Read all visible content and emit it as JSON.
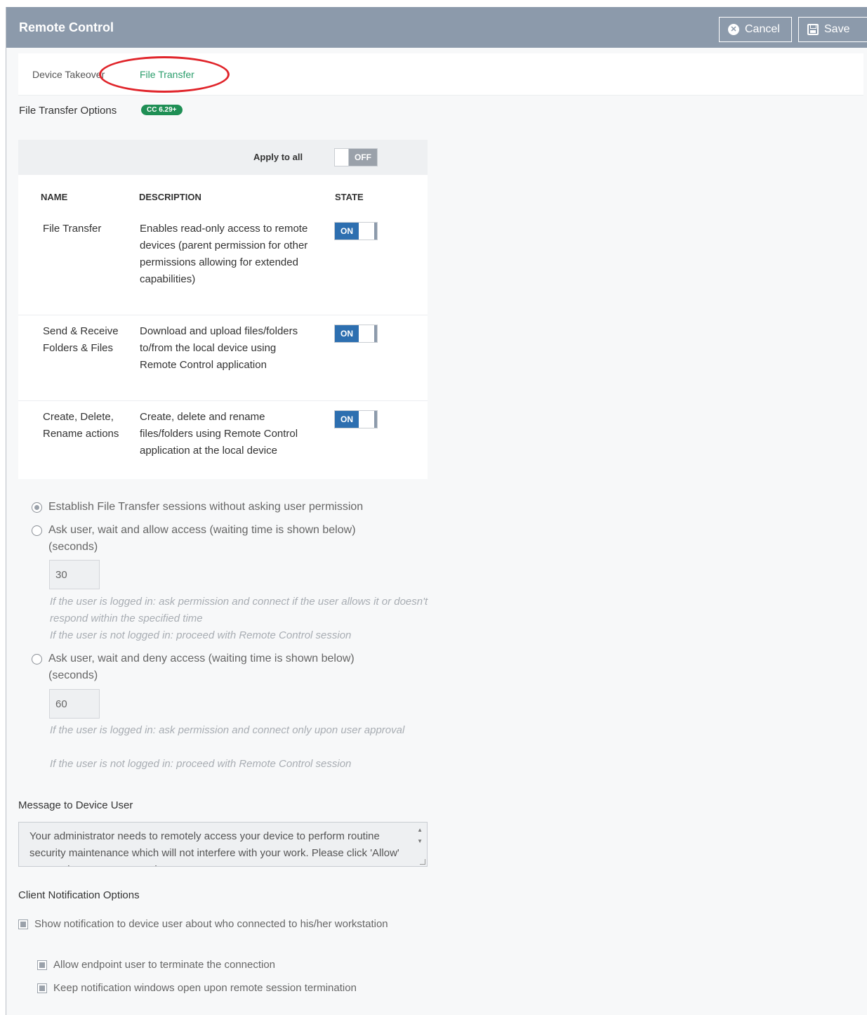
{
  "header": {
    "title": "Remote Control",
    "cancel_label": "Cancel",
    "save_label": "Save",
    "bg_color": "#8c9aab"
  },
  "tabs": [
    {
      "label": "Device Takeover",
      "active": false
    },
    {
      "label": "File Transfer",
      "active": true
    }
  ],
  "section": {
    "title": "File Transfer Options",
    "badge": "CC 6.29+"
  },
  "table": {
    "apply_to_all_label": "Apply to all",
    "apply_to_all_state": "OFF",
    "headers": {
      "name": "NAME",
      "description": "DESCRIPTION",
      "state": "STATE"
    },
    "rows": [
      {
        "name": "File Transfer",
        "description": "Enables read-only access to remote devices (parent permission for other permissions allowing for extended capabilities)",
        "state": "ON"
      },
      {
        "name": "Send & Receive Folders & Files",
        "description": "Download and upload files/folders to/from the local device using Remote Control application",
        "state": "ON"
      },
      {
        "name": "Create, Delete, Rename actions",
        "description": "Create, delete and rename files/folders using Remote Control application at the local device",
        "state": "ON"
      }
    ]
  },
  "session_options": {
    "selected": 0,
    "opt1": "Establish File Transfer sessions without asking user permission",
    "opt2": "Ask user, wait and allow access (waiting time is shown below) (seconds)",
    "opt2_value": "30",
    "opt2_note1": "If the user is logged in: ask permission and connect if the user allows it or doesn't respond within the specified time",
    "opt2_note2": "If the user is not logged in: proceed with Remote Control session",
    "opt3": "Ask user, wait and deny access (waiting time is shown below) (seconds)",
    "opt3_value": "60",
    "opt3_note1": "If the user is logged in: ask permission and connect only upon user approval",
    "opt3_note2": "If the user is not logged in: proceed with Remote Control session"
  },
  "message": {
    "title": "Message to Device User",
    "text": "Your administrator needs to remotely access your device to perform routine security maintenance which will not interfere with your work. Please click 'Allow' to start the remote connection."
  },
  "client_notification": {
    "title": "Client Notification Options",
    "show_notification": "Show notification to device user about who connected to his/her workstation",
    "allow_terminate": "Allow endpoint user to terminate the connection",
    "keep_open": "Keep notification windows open upon remote session termination"
  },
  "colors": {
    "accent_green": "#2a9d6b",
    "on_blue": "#2d6fb0",
    "annotation_red": "#e0242a"
  }
}
